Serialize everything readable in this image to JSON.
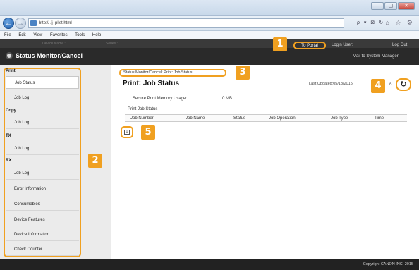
{
  "browser": {
    "url": "http://                    /j_plist.html",
    "url_controls": "ρ ▾ ⊠ ↻",
    "home_icons": "⌂ ☆ ⚙",
    "win_buttons": [
      "—",
      "▢",
      "✕"
    ],
    "menu": [
      "File",
      "Edit",
      "View",
      "Favorites",
      "Tools",
      "Help"
    ]
  },
  "header": {
    "app_title": "Status Monitor/Cancel",
    "blurred_a": "Device Name :",
    "blurred_b": "Series :",
    "to_portal": "To Portal",
    "login_user": "Login User:",
    "log_out": "Log Out",
    "mail_to_sys": "Mail to System Manager"
  },
  "callouts": [
    "1",
    "2",
    "3",
    "4",
    "5"
  ],
  "sidebar": {
    "sections": [
      {
        "title": "Print",
        "items": [
          {
            "label": "Job Status",
            "active": true
          },
          {
            "label": "Job Log"
          }
        ]
      },
      {
        "title": "Copy",
        "items": [
          {
            "label": "Job Log"
          }
        ]
      },
      {
        "title": "TX",
        "items": [
          {
            "label": "Job Log"
          }
        ]
      },
      {
        "title": "RX",
        "items": [
          {
            "label": "Job Log"
          }
        ]
      }
    ],
    "extra_items": [
      "Error Information",
      "Consumables",
      "Device Features",
      "Device Information",
      "Check Counter"
    ]
  },
  "main": {
    "breadcrumb": "Status Monitor/Cancel: Print: Job Status",
    "title": "Print: Job Status",
    "last_updated": "Last Updated:05/13/2015",
    "aa": "A",
    "refresh_icon": "↻",
    "secure_label": "Secure Print Memory Usage:",
    "secure_value": "0 MB",
    "print_job_status": "Print Job Status",
    "columns": [
      "Job Number",
      "Job Name",
      "Status",
      "Job Operation",
      "Job Type",
      "Time"
    ],
    "download_icon": "▤"
  },
  "footer": {
    "copyright": "Copyright CANON INC. 2015"
  },
  "colors": {
    "accent": "#f0a020",
    "header": "#2a2a2a"
  }
}
